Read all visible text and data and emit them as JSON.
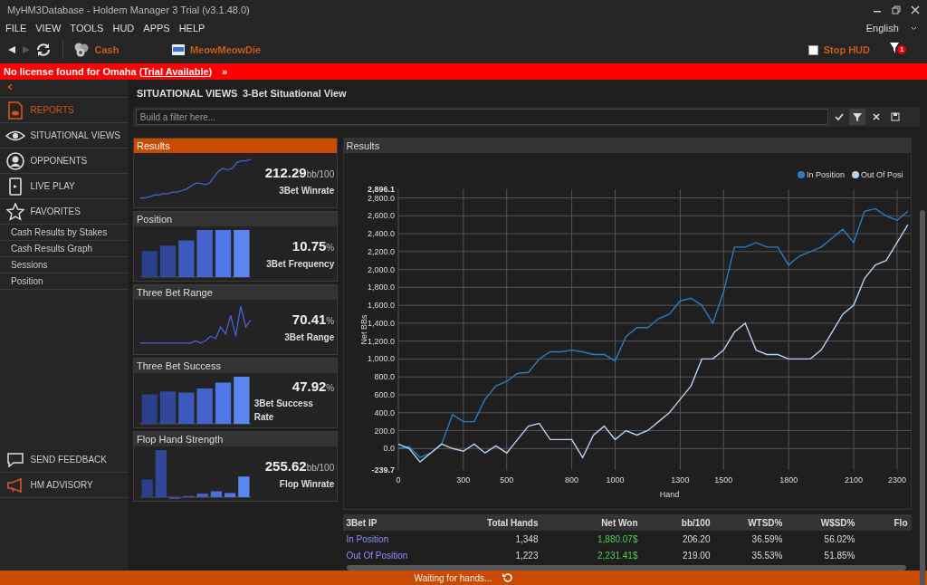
{
  "window": {
    "title": "MyHM3Database - Holdem Manager 3 Trial (v3.1.48.0)"
  },
  "menu": [
    "FILE",
    "VIEW",
    "TOOLS",
    "HUD",
    "APPS",
    "HELP"
  ],
  "language": {
    "value": "English"
  },
  "toolbar": {
    "cash": "Cash",
    "account": "MeowMeowDie",
    "stop_hud": {
      "label": "Stop HUD",
      "checked": false
    },
    "notifications": "1"
  },
  "banner": {
    "text": "No license found for Omaha (",
    "link": "Trial Available",
    "after": ")",
    "chevron": "»"
  },
  "sidebar": {
    "items": [
      {
        "label": "REPORTS",
        "selected": true
      },
      {
        "label": "SITUATIONAL VIEWS",
        "selected": false
      },
      {
        "label": "OPPONENTS",
        "selected": false
      },
      {
        "label": "LIVE PLAY",
        "selected": false
      },
      {
        "label": "FAVORITES",
        "selected": false,
        "children": [
          {
            "label": "Cash Results by Stakes",
            "selected": false
          },
          {
            "label": "Cash Results Graph",
            "selected": false
          },
          {
            "label": "Sessions",
            "selected": false
          },
          {
            "label": "Position",
            "selected": false
          }
        ]
      }
    ],
    "bottom": [
      {
        "label": "SEND FEEDBACK"
      },
      {
        "label": "HM ADVISORY"
      }
    ]
  },
  "breadcrumb": {
    "section": "SITUATIONAL VIEWS",
    "page": "3-Bet Situational View"
  },
  "filter": {
    "placeholder": "Build a filter here..."
  },
  "cards": [
    {
      "title": "Results",
      "kind": "line",
      "value": "212.29",
      "unit": "bb/100",
      "caption": "3Bet Winrate",
      "selected": true
    },
    {
      "title": "Position",
      "kind": "bars",
      "value": "10.75",
      "unit": "%",
      "caption": "3Bet Frequency",
      "selected": false
    },
    {
      "title": "Three Bet Range",
      "kind": "line",
      "value": "70.41",
      "unit": "%",
      "caption": "3Bet Range",
      "selected": false
    },
    {
      "title": "Three Bet Success",
      "kind": "bars",
      "value": "47.92",
      "unit": "%",
      "caption": "3Bet Success Rate",
      "selected": false
    },
    {
      "title": "Flop Hand Strength",
      "kind": "bars",
      "value": "255.62",
      "unit": "bb/100",
      "caption": "Flop Winrate",
      "selected": false
    }
  ],
  "results": {
    "title": "Results",
    "chart_data": {
      "type": "line",
      "xlabel": "Hand",
      "ylabel": "Net BBs",
      "x": [
        0,
        50,
        100,
        150,
        200,
        250,
        300,
        350,
        400,
        450,
        500,
        550,
        600,
        650,
        700,
        750,
        800,
        850,
        900,
        950,
        1000,
        1050,
        1100,
        1150,
        1200,
        1250,
        1300,
        1350,
        1400,
        1450,
        1500,
        1550,
        1600,
        1650,
        1700,
        1750,
        1800,
        1850,
        1900,
        1950,
        2000,
        2050,
        2100,
        2150,
        2200,
        2250,
        2300,
        2350
      ],
      "series": [
        {
          "name": "In Position",
          "color": "#2b7cc0",
          "values": [
            0,
            20,
            -100,
            -50,
            50,
            380,
            300,
            300,
            550,
            700,
            750,
            840,
            850,
            1000,
            1080,
            1080,
            1100,
            1080,
            1050,
            1050,
            980,
            1250,
            1350,
            1350,
            1450,
            1500,
            1650,
            1680,
            1600,
            1400,
            1750,
            2250,
            2250,
            2300,
            2250,
            2250,
            2050,
            2150,
            2200,
            2250,
            2350,
            2450,
            2300,
            2650,
            2680,
            2600,
            2550,
            2650
          ]
        },
        {
          "name": "Out Of Posi",
          "color": "#b8d0ee",
          "values": [
            50,
            0,
            -150,
            -50,
            50,
            0,
            -30,
            50,
            -50,
            30,
            -50,
            100,
            250,
            280,
            100,
            100,
            100,
            -100,
            150,
            250,
            100,
            200,
            150,
            200,
            300,
            400,
            550,
            700,
            1000,
            1000,
            1100,
            1300,
            1400,
            1100,
            1050,
            1050,
            1000,
            1000,
            1000,
            1100,
            1300,
            1500,
            1600,
            1900,
            2050,
            2100,
            2300,
            2500
          ]
        }
      ],
      "xlim": [
        0,
        2363
      ],
      "ylim": [
        -239.7,
        2896.1
      ],
      "grid": true,
      "legend": true,
      "xticks": [
        0,
        300,
        500,
        800,
        1000,
        1300,
        1500,
        1800,
        2100,
        2300
      ],
      "yticks": [
        {
          "value": -239.7,
          "label": "-239.7"
        },
        {
          "value": 0,
          "label": "0.0"
        },
        {
          "value": 200,
          "label": "200.0"
        },
        {
          "value": 400,
          "label": "400.0"
        },
        {
          "value": 600,
          "label": "600.0"
        },
        {
          "value": 800,
          "label": "800.0"
        },
        {
          "value": 1000,
          "label": "1,000.0"
        },
        {
          "value": 1200,
          "label": "1,200.0"
        },
        {
          "value": 1400,
          "label": "1,400.0"
        },
        {
          "value": 1600,
          "label": "1,600.0"
        },
        {
          "value": 1800,
          "label": "1,800.0"
        },
        {
          "value": 2000,
          "label": "2,000.0"
        },
        {
          "value": 2200,
          "label": "2,200.0"
        },
        {
          "value": 2400,
          "label": "2,400.0"
        },
        {
          "value": 2600,
          "label": "2,600.0"
        },
        {
          "value": 2800,
          "label": "2,800.0"
        },
        {
          "value": 2896.1,
          "label": "2,896.1"
        }
      ]
    }
  },
  "table": {
    "columns": [
      "3Bet IP",
      "Total Hands",
      "Net Won",
      "bb/100",
      "WTSD%",
      "W$SD%",
      "Flo"
    ],
    "rows": [
      {
        "cells": [
          "In Position",
          "1,348",
          "1,880.07$",
          "206.20",
          "36.59%",
          "56.02%"
        ]
      },
      {
        "cells": [
          "Out Of Position",
          "1,223",
          "2,231.41$",
          "219.00",
          "35.53%",
          "51.85%"
        ]
      }
    ]
  },
  "status_bar": {
    "text": "Waiting for hands..."
  }
}
